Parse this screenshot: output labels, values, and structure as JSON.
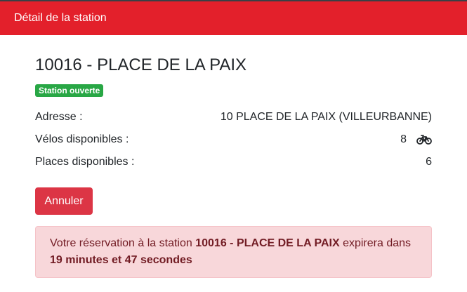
{
  "header": {
    "title": "Détail de la station"
  },
  "station": {
    "title": "10016 - PLACE DE LA PAIX",
    "status_badge": "Station ouverte"
  },
  "details": {
    "address_label": "Adresse :",
    "address_value": "10 PLACE DE LA PAIX (VILLEURBANNE)",
    "bikes_label": "Vélos disponibles :",
    "bikes_value": "8",
    "bike_icon": "bicycle-icon",
    "places_label": "Places disponibles :",
    "places_value": "6"
  },
  "actions": {
    "cancel_label": "Annuler"
  },
  "alert": {
    "prefix": "Votre réservation à la station ",
    "station": "10016 - PLACE DE LA PAIX",
    "middle": " expirera dans",
    "countdown": "19 minutes et 47 secondes"
  },
  "colors": {
    "header_bg": "#e3202b",
    "badge_bg": "#28a745",
    "button_bg": "#dc3545",
    "alert_bg": "#f8d7da",
    "alert_text": "#721c24"
  }
}
